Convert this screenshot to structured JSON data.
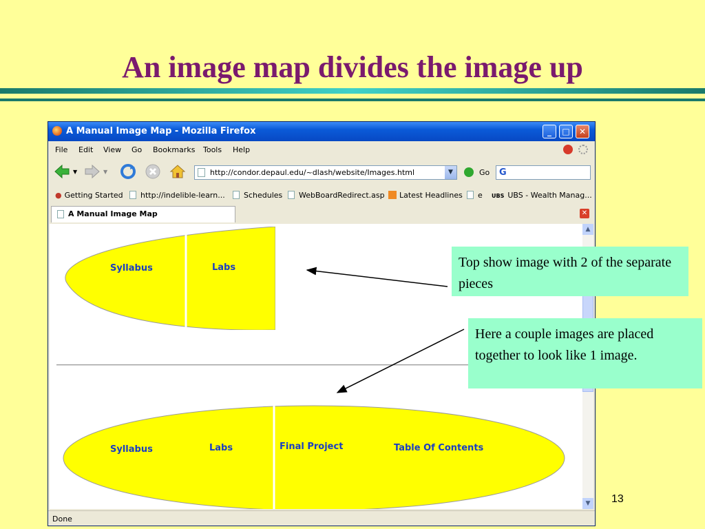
{
  "slide": {
    "title": "An image map divides the image up",
    "number": "13",
    "callouts": [
      "Top show image with 2 of the separate pieces",
      "Here a couple images are placed together to look like 1 image."
    ]
  },
  "browser": {
    "window_title": "A Manual Image Map - Mozilla Firefox",
    "menu": [
      "File",
      "Edit",
      "View",
      "Go",
      "Bookmarks",
      "Tools",
      "Help"
    ],
    "url": "http://condor.depaul.edu/~dlash/website/Images.html",
    "go_label": "Go",
    "bookmarks": [
      "Getting Started",
      "http://indelible-learn...",
      "Schedules",
      "WebBoardRedirect.asp",
      "Latest Headlines",
      "e",
      "UBS - Wealth Manag..."
    ],
    "tab_title": "A Manual Image Map",
    "status": "Done"
  },
  "page": {
    "top_map": [
      "Syllabus",
      "Labs"
    ],
    "bottom_map": [
      "Syllabus",
      "Labs",
      "Final Project",
      "Table Of Contents"
    ]
  },
  "colors": {
    "map_fill": "#ffff00",
    "map_text": "#1a3ec2",
    "callout_bg": "#99ffcc",
    "title": "#7a1a6e"
  }
}
